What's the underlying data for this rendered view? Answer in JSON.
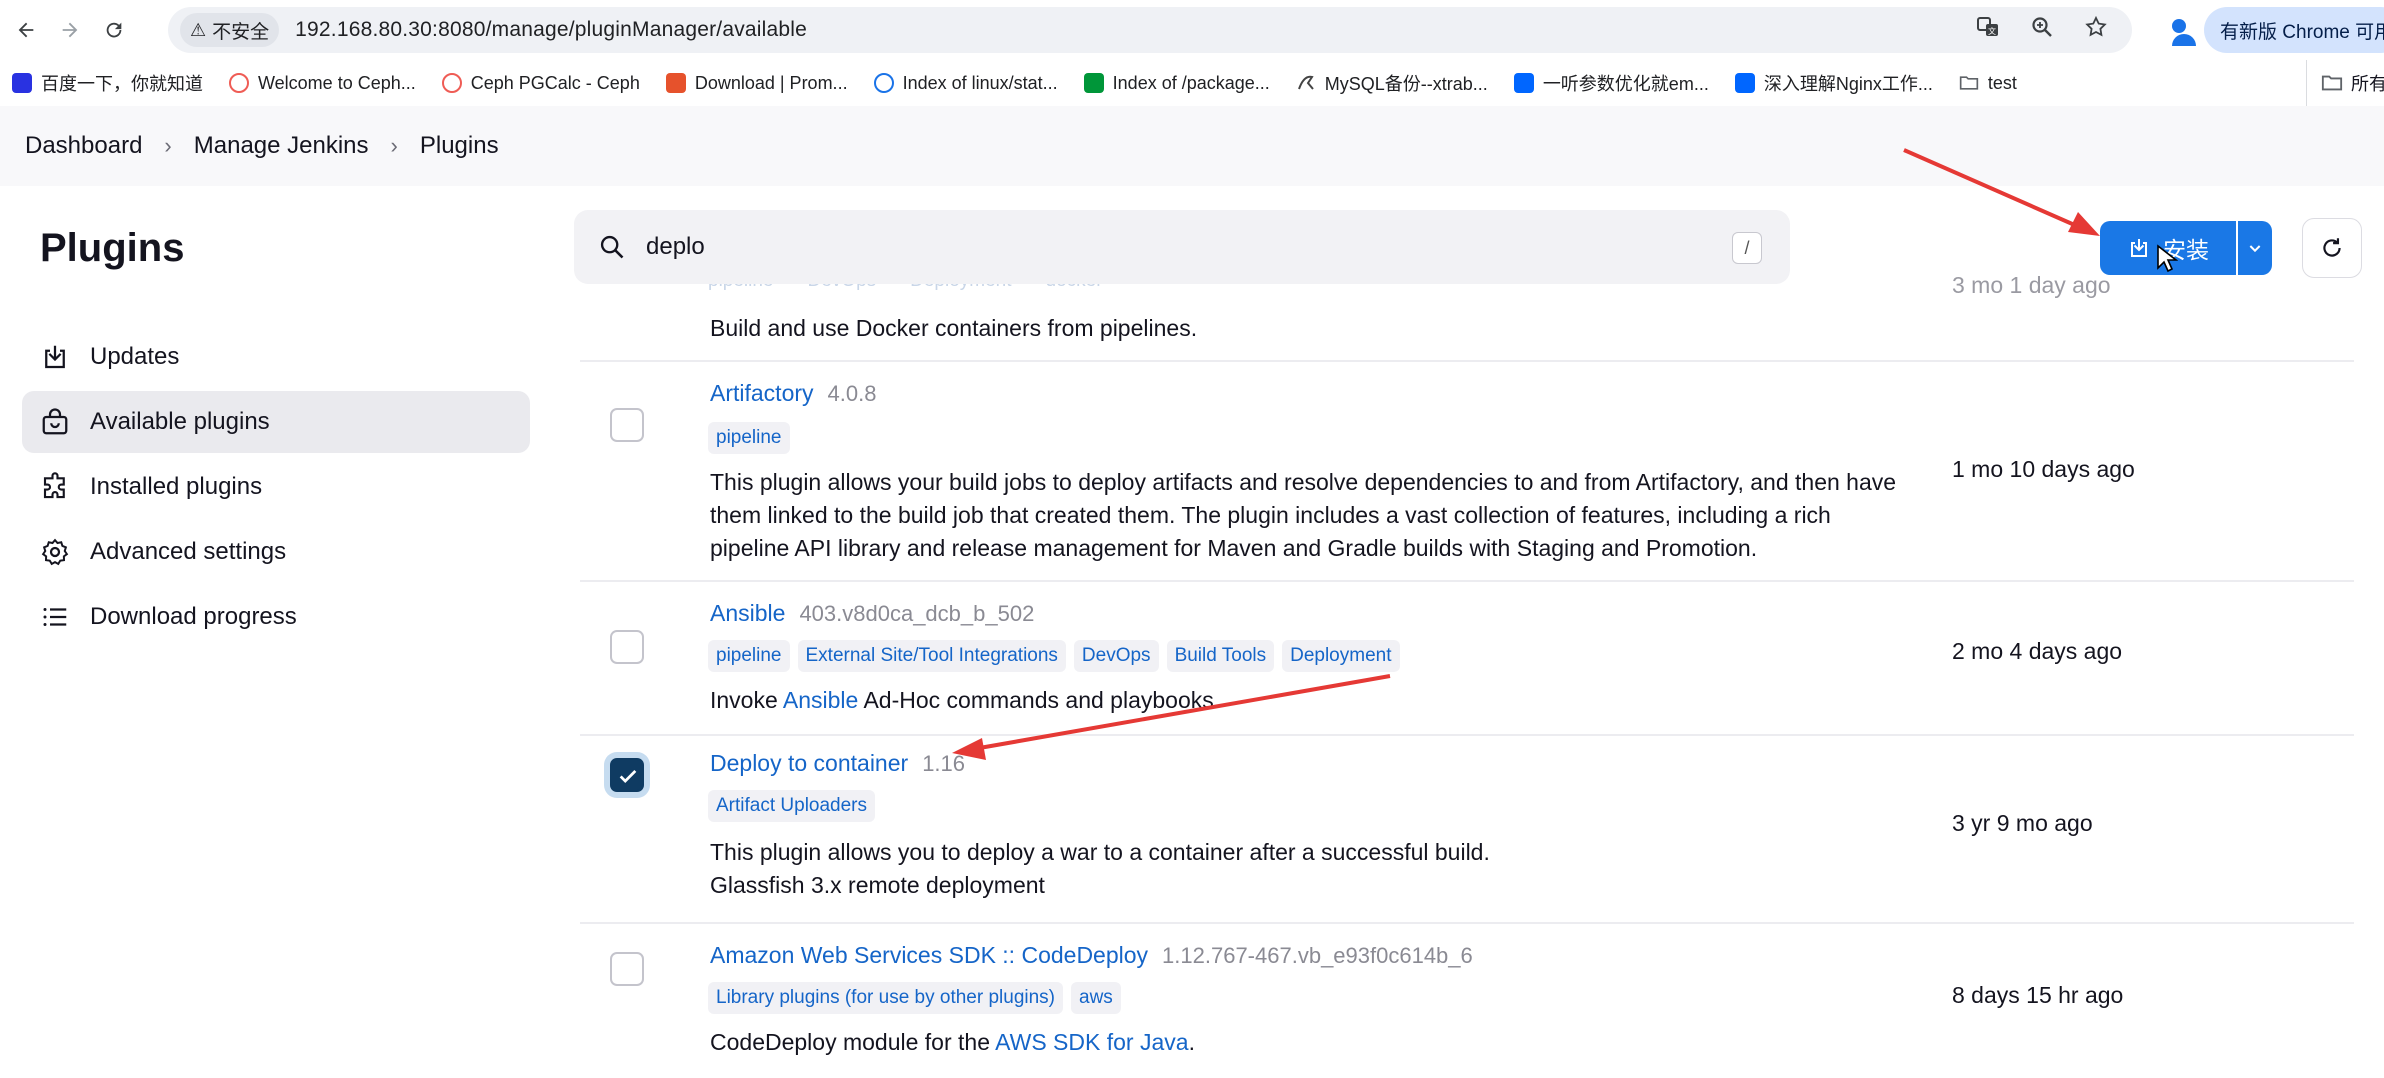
{
  "browser": {
    "security_label": "不安全",
    "url": "192.168.80.30:8080/manage/pluginManager/available",
    "update_label": "有新版 Chrome 可用",
    "bookmarks": [
      {
        "label": "百度一下，你就知道",
        "icon": "baidu-icon",
        "color": "#2932e1"
      },
      {
        "label": "Welcome to Ceph...",
        "icon": "ceph-icon",
        "color": "#ef5c55"
      },
      {
        "label": "Ceph PGCalc - Ceph",
        "icon": "ceph-icon",
        "color": "#ef5c55"
      },
      {
        "label": "Download | Prom...",
        "icon": "prometheus-icon",
        "color": "#e6522c"
      },
      {
        "label": "Index of linux/stat...",
        "icon": "globe-icon",
        "color": "#1a73e8"
      },
      {
        "label": "Index of /package...",
        "icon": "nginx-icon",
        "color": "#009639"
      },
      {
        "label": "MySQL备份--xtrab...",
        "icon": "mysql-icon",
        "color": "#444444"
      },
      {
        "label": "一听参数优化就em...",
        "icon": "zhihu-icon",
        "color": "#0066ff"
      },
      {
        "label": "深入理解Nginx工作...",
        "icon": "zhihu-icon",
        "color": "#0066ff"
      },
      {
        "label": "test",
        "icon": "folder-icon",
        "color": "#5f6368"
      }
    ],
    "all_bookmarks_label": "所有书签"
  },
  "breadcrumb": [
    "Dashboard",
    "Manage Jenkins",
    "Plugins"
  ],
  "sidebar": {
    "title": "Plugins",
    "items": [
      {
        "label": "Updates",
        "icon": "download-icon",
        "active": false
      },
      {
        "label": "Available plugins",
        "icon": "shopping-bag-icon",
        "active": true
      },
      {
        "label": "Installed plugins",
        "icon": "puzzle-icon",
        "active": false
      },
      {
        "label": "Advanced settings",
        "icon": "gear-icon",
        "active": false
      },
      {
        "label": "Download progress",
        "icon": "list-icon",
        "active": false
      }
    ]
  },
  "search": {
    "query": "deplo",
    "shortcut": "/"
  },
  "actions": {
    "install_label": "安装"
  },
  "plugins": {
    "top_row": {
      "tags": [
        "pipeline",
        "DevOps",
        "Deployment",
        "docker"
      ],
      "description": "Build and use Docker containers from pipelines.",
      "released": "3 mo 1 day ago"
    },
    "artifactory": {
      "name": "Artifactory",
      "version": "4.0.8",
      "tags": [
        "pipeline"
      ],
      "description": "This plugin allows your build jobs to deploy artifacts and resolve dependencies to and from Artifactory, and then have them linked to the build job that created them. The plugin includes a vast collection of features, including a rich pipeline API library and release management for Maven and Gradle builds with Staging and Promotion.",
      "released": "1 mo 10 days ago",
      "checked": false
    },
    "ansible": {
      "name": "Ansible",
      "version": "403.v8d0ca_dcb_b_502",
      "tags": [
        "pipeline",
        "External Site/Tool Integrations",
        "DevOps",
        "Build Tools",
        "Deployment"
      ],
      "desc_before": "Invoke ",
      "desc_link": "Ansible",
      "desc_after": " Ad-Hoc commands and playbooks.",
      "released": "2 mo 4 days ago",
      "checked": false
    },
    "deploy": {
      "name": "Deploy to container",
      "version": "1.16",
      "tags": [
        "Artifact Uploaders"
      ],
      "desc_line1": "This plugin allows you to deploy a war to a container after a successful build.",
      "desc_line2": "Glassfish 3.x remote deployment",
      "released": "3 yr 9 mo ago",
      "checked": true
    },
    "aws": {
      "name": "Amazon Web Services SDK :: CodeDeploy",
      "version": "1.12.767-467.vb_e93f0c614b_6",
      "tags": [
        "Library plugins (for use by other plugins)",
        "aws"
      ],
      "desc_before": "CodeDeploy module for the ",
      "desc_link": "AWS SDK for Java",
      "desc_after": ".",
      "released": "8 days 15 hr ago",
      "checked": false
    }
  },
  "colors": {
    "accent": "#1a78e6",
    "link": "#1565c8",
    "annotation_arrow": "#e53935"
  }
}
